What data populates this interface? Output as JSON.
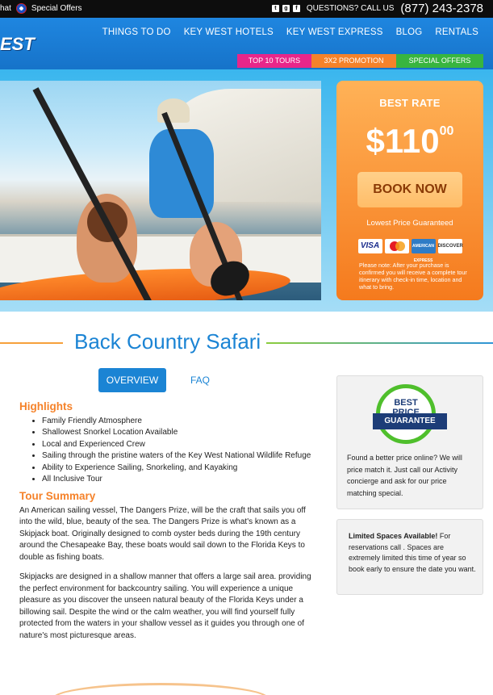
{
  "topbar": {
    "left_text": "hat",
    "special_offers": "Special Offers",
    "social_icons": [
      "twitter-icon",
      "googleplus-icon",
      "facebook-icon"
    ],
    "questions": "QUESTIONS? CALL US",
    "phone": "(877) 243-2378"
  },
  "nav": {
    "logo": "EST",
    "links": [
      "THINGS TO DO",
      "KEY WEST HOTELS",
      "KEY WEST EXPRESS",
      "BLOG",
      "RENTALS"
    ],
    "promos": [
      "TOP 10 TOURS",
      "3X2 PROMOTION",
      "SPECIAL OFFERS"
    ]
  },
  "rate": {
    "label": "BEST RATE",
    "price": "$110",
    "cents": "00",
    "book_label": "BOOK NOW",
    "guarantee": "Lowest Price Guaranteed",
    "cards": [
      "VISA",
      "",
      "AMERICAN EXPRESS",
      "DISCOVER"
    ],
    "note": "Please note: After your purchase is confirmed you will receive a complete tour itinerary with check-in time, location and what to bring."
  },
  "page": {
    "title": "Back Country Safari",
    "tab_overview": "OVERVIEW",
    "tab_faq": "FAQ"
  },
  "highlights": {
    "heading": "Highlights",
    "items": [
      "Family Friendly Atmosphere",
      "Shallowest Snorkel Location Available",
      "Local and Experienced Crew",
      "Sailing through the pristine waters of the Key West National Wildlife Refuge",
      "Ability to Experience Sailing, Snorkeling, and Kayaking",
      "All Inclusive Tour"
    ]
  },
  "summary": {
    "heading": "Tour Summary",
    "p1": "An American sailing vessel, The Dangers Prize, will be the craft that sails you off into the wild, blue, beauty of the sea. The Dangers Prize is what's known as a Skipjack boat. Originally designed to comb oyster beds during the 19th century around the Chesapeake Bay, these boats would sail down to the Florida Keys to double as fishing boats.",
    "p2": "Skipjacks are designed in a shallow manner that offers a large sail area. providing the perfect environment for backcountry sailing. You will experience a unique pleasure as you discover the unseen natural beauty of the Florida Keys under a billowing sail. Despite the wind or the calm weather, you will find yourself fully protected from the waters in your shallow vessel as it guides you through one of nature's most picturesque areas."
  },
  "side": {
    "seal_line1": "BEST",
    "seal_line2": "PRICE",
    "seal_ribbon": "GUARANTEE",
    "match_text": "Found a better price online? We will price match it. Just call our Activity concierge and ask for our price matching special.",
    "limited_title": "Limited Spaces Available!",
    "limited_text": " For reservations call . Spaces are extremely limited this time of year so book early to ensure the date you want."
  },
  "colors": {
    "brand_blue": "#1b84d4",
    "accent_orange": "#f5822a",
    "promo_pink": "#e8268a",
    "promo_green": "#38b53f"
  }
}
